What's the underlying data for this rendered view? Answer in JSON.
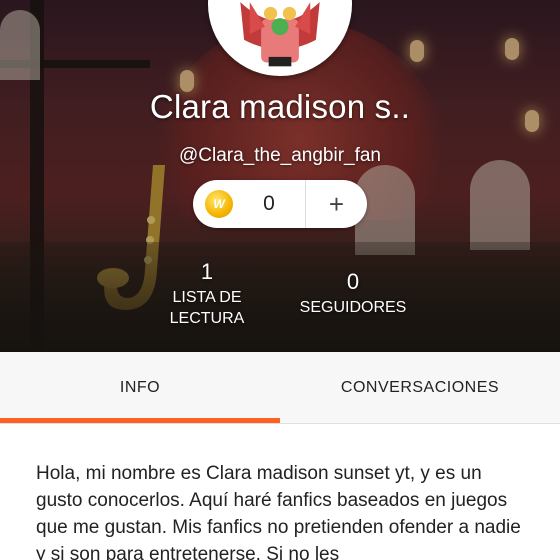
{
  "profile": {
    "display_name": "Clara madison s..",
    "username": "@Clara_the_angbir_fan",
    "avatar_icon": "avatar-character-icon"
  },
  "coins": {
    "icon": "coin-icon",
    "icon_letter": "W",
    "count": "0",
    "add_label": "+"
  },
  "stats": {
    "reading_lists": {
      "value": "1",
      "label_line1": "LISTA DE",
      "label_line2": "LECTURA"
    },
    "followers": {
      "value": "0",
      "label": "SEGUIDORES"
    }
  },
  "tabs": [
    {
      "label": "INFO",
      "active": true
    },
    {
      "label": "CONVERSACIONES",
      "active": false
    }
  ],
  "about": {
    "bio": "Hola, mi nombre es Clara madison sunset yt, y es un gusto conocerlos. Aquí haré fanfics baseados en juegos que me gustan. Mis fanfics no pretienden ofender a nadie y si son para entretenerse. Si no les"
  },
  "colors": {
    "accent": "#ff6122",
    "coin": "#f5b400",
    "tab_bg": "#f7f7f7"
  }
}
